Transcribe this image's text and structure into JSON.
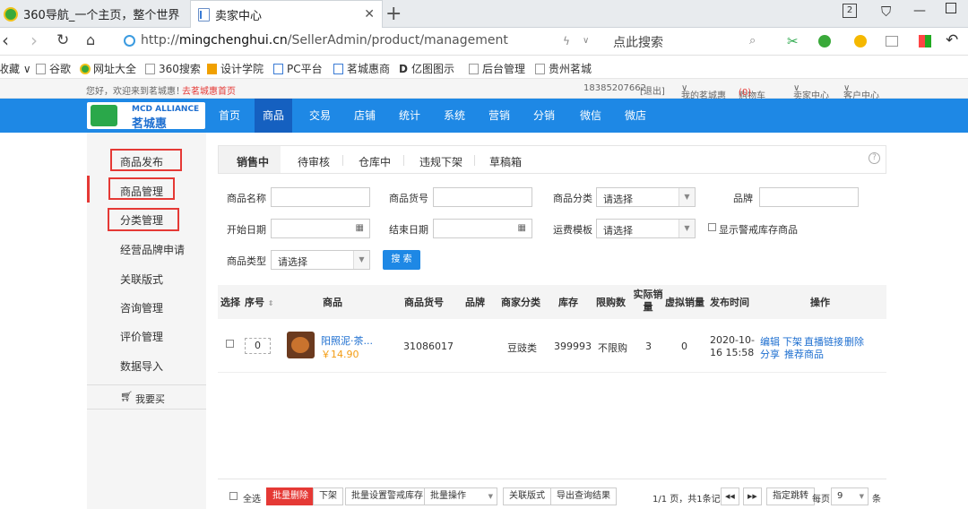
{
  "browser": {
    "tabs": [
      {
        "title": "360导航_一个主页，整个世界"
      },
      {
        "title": "卖家中心"
      }
    ],
    "new_tab": "+",
    "tab_count": "2",
    "url_prefix": "http://",
    "url_host": "mingchenghui.cn",
    "url_path": "/SellerAdmin/product/management",
    "search_placeholder": "点此搜索",
    "bookmarks": [
      "收藏",
      "谷歌",
      "网址大全",
      "360搜索",
      "设计学院",
      "PC平台",
      "茗城惠商",
      "亿图图示",
      "后台管理",
      "贵州茗城"
    ]
  },
  "topbar": {
    "welcome": "您好，欢迎来到茗城惠！",
    "home_link": "去茗城惠首页",
    "phone": "18385207662",
    "logout": "[退出]",
    "my_account": "我的茗城惠",
    "cart": "购物车",
    "cart_count": "(0)",
    "seller_center": "卖家中心",
    "customer_center": "客户中心"
  },
  "logo": {
    "en": "MCD ALLIANCE",
    "cn": "茗城惠"
  },
  "nav": [
    "首页",
    "商品",
    "交易",
    "店铺",
    "统计",
    "系统",
    "营销",
    "分销",
    "微信",
    "微店"
  ],
  "sidebar": {
    "items": [
      "商品发布",
      "商品管理",
      "分类管理",
      "经营品牌申请",
      "关联版式",
      "咨询管理",
      "评价管理",
      "数据导入"
    ],
    "buy": "我要买"
  },
  "content_tabs": [
    "销售中",
    "待审核",
    "仓库中",
    "违规下架",
    "草稿箱"
  ],
  "filters": {
    "name": "商品名称",
    "sku": "商品货号",
    "category": "商品分类",
    "brand": "品牌",
    "start": "开始日期",
    "end": "结束日期",
    "shipping": "运费模板",
    "show_warn": "显示警戒库存商品",
    "type": "商品类型",
    "select": "请选择",
    "search": "搜 索"
  },
  "table": {
    "headers": [
      "选择",
      "序号",
      "商品",
      "商品货号",
      "品牌",
      "商家分类",
      "库存",
      "限购数",
      "实际销量",
      "虚拟销量",
      "发布时间",
      "操作"
    ],
    "rows": [
      {
        "seq": "0",
        "name": "阳照泥·茶...",
        "price": "￥14.90",
        "sku": "31086017",
        "brand": "",
        "category": "豆豉类",
        "stock": "399993",
        "limit": "不限购",
        "sales": "3",
        "virtual": "0",
        "date": "2020-10-",
        "time": "16 15:58",
        "ops1": [
          "编辑",
          "下架",
          "直播链接",
          "删除"
        ],
        "ops2": [
          "分享",
          "推荐商品"
        ]
      }
    ]
  },
  "footer": {
    "select_all": "全选",
    "batch_delete": "批量删除",
    "offshelf": "下架",
    "set_warn": "批量设置警戒库存",
    "batch_ops": "批量操作",
    "related": "关联版式",
    "export": "导出查询结果",
    "page_info": "1/1 页，共1条记录",
    "prev": "◀◀",
    "next": "▶▶",
    "jump": "指定跳转",
    "per_page": "每页",
    "per_page_value": "9",
    "unit": "条"
  },
  "colors": {
    "accent": "#1e88e5",
    "highlight": "#e53935",
    "link": "#1e6fd0"
  }
}
